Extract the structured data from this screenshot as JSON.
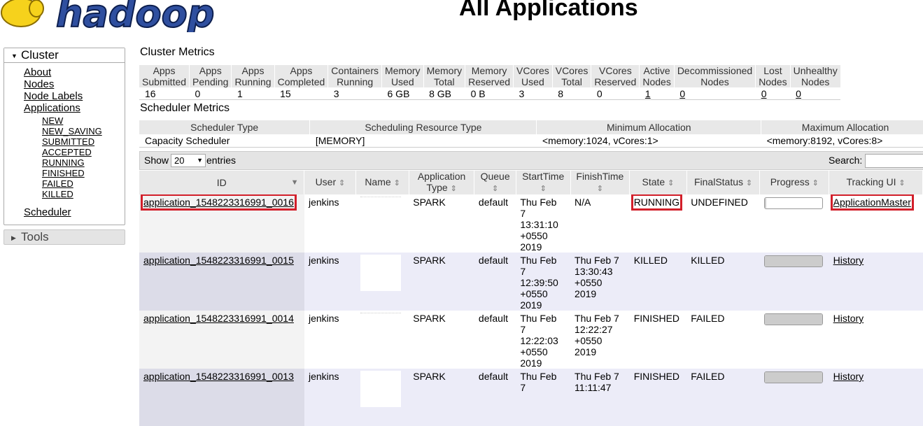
{
  "header": {
    "title": "All Applications",
    "logo_text": "hadoop"
  },
  "nav": {
    "cluster_label": "Cluster",
    "items": [
      "About",
      "Nodes",
      "Node Labels",
      "Applications"
    ],
    "app_states": [
      "NEW",
      "NEW_SAVING",
      "SUBMITTED",
      "ACCEPTED",
      "RUNNING",
      "FINISHED",
      "FAILED",
      "KILLED"
    ],
    "scheduler_label": "Scheduler",
    "tools_label": "Tools"
  },
  "cluster_metrics": {
    "title": "Cluster Metrics",
    "headers": [
      [
        "Apps",
        "Submitted"
      ],
      [
        "Apps",
        "Pending"
      ],
      [
        "Apps",
        "Running"
      ],
      [
        "Apps",
        "Completed"
      ],
      [
        "Containers",
        "Running"
      ],
      [
        "Memory",
        "Used"
      ],
      [
        "Memory",
        "Total"
      ],
      [
        "Memory",
        "Reserved"
      ],
      [
        "VCores",
        "Used"
      ],
      [
        "VCores",
        "Total"
      ],
      [
        "VCores",
        "Reserved"
      ],
      [
        "Active",
        "Nodes"
      ],
      [
        "Decommissioned",
        "Nodes"
      ],
      [
        "Lost",
        "Nodes"
      ],
      [
        "Unhealthy",
        "Nodes"
      ]
    ],
    "values": [
      "16",
      "0",
      "1",
      "15",
      "3",
      "6 GB",
      "8 GB",
      "0 B",
      "3",
      "8",
      "0",
      "1",
      "0",
      "0",
      "0"
    ]
  },
  "scheduler_metrics": {
    "title": "Scheduler Metrics",
    "headers": [
      "Scheduler Type",
      "Scheduling Resource Type",
      "Minimum Allocation",
      "Maximum Allocation"
    ],
    "values": [
      "Capacity Scheduler",
      "[MEMORY]",
      "<memory:1024, vCores:1>",
      "<memory:8192, vCores:8>"
    ]
  },
  "toolbar": {
    "show_label": "Show",
    "entries_value": "20",
    "entries_label": "entries",
    "search_label": "Search:"
  },
  "apps_table": {
    "headers": [
      "ID",
      "User",
      "Name",
      "Application Type",
      "Queue",
      "StartTime",
      "FinishTime",
      "State",
      "FinalStatus",
      "Progress",
      "Tracking UI"
    ],
    "rows": [
      {
        "id": "application_1548223316991_0016",
        "user": "jenkins",
        "type": "SPARK",
        "queue": "default",
        "start": [
          "Thu Feb",
          "7",
          "13:31:10",
          "+0550",
          "2019"
        ],
        "finish": [
          "N/A"
        ],
        "state": "RUNNING",
        "final": "UNDEFINED",
        "progress": 0.02,
        "tracking": "ApplicationMaster"
      },
      {
        "id": "application_1548223316991_0015",
        "user": "jenkins",
        "type": "SPARK",
        "queue": "default",
        "start": [
          "Thu Feb",
          "7",
          "12:39:50",
          "+0550",
          "2019"
        ],
        "finish": [
          "Thu Feb 7",
          "13:30:43",
          "+0550",
          "2019"
        ],
        "state": "KILLED",
        "final": "KILLED",
        "progress": 1.0,
        "tracking": "History"
      },
      {
        "id": "application_1548223316991_0014",
        "user": "jenkins",
        "type": "SPARK",
        "queue": "default",
        "start": [
          "Thu Feb",
          "7",
          "12:22:03",
          "+0550",
          "2019"
        ],
        "finish": [
          "Thu Feb 7",
          "12:22:27",
          "+0550",
          "2019"
        ],
        "state": "FINISHED",
        "final": "FAILED",
        "progress": 1.0,
        "tracking": "History"
      },
      {
        "id": "application_1548223316991_0013",
        "user": "jenkins",
        "type": "SPARK",
        "queue": "default",
        "start": [
          "Thu Feb",
          "7"
        ],
        "finish": [
          "Thu Feb 7",
          "11:11:47"
        ],
        "state": "FINISHED",
        "final": "FAILED",
        "progress": 1.0,
        "tracking": "History"
      }
    ]
  },
  "colors": {
    "highlight": "#d21f2a",
    "logo_fill": "#2f4f9f",
    "logo_elephant": "#f6d21c"
  }
}
